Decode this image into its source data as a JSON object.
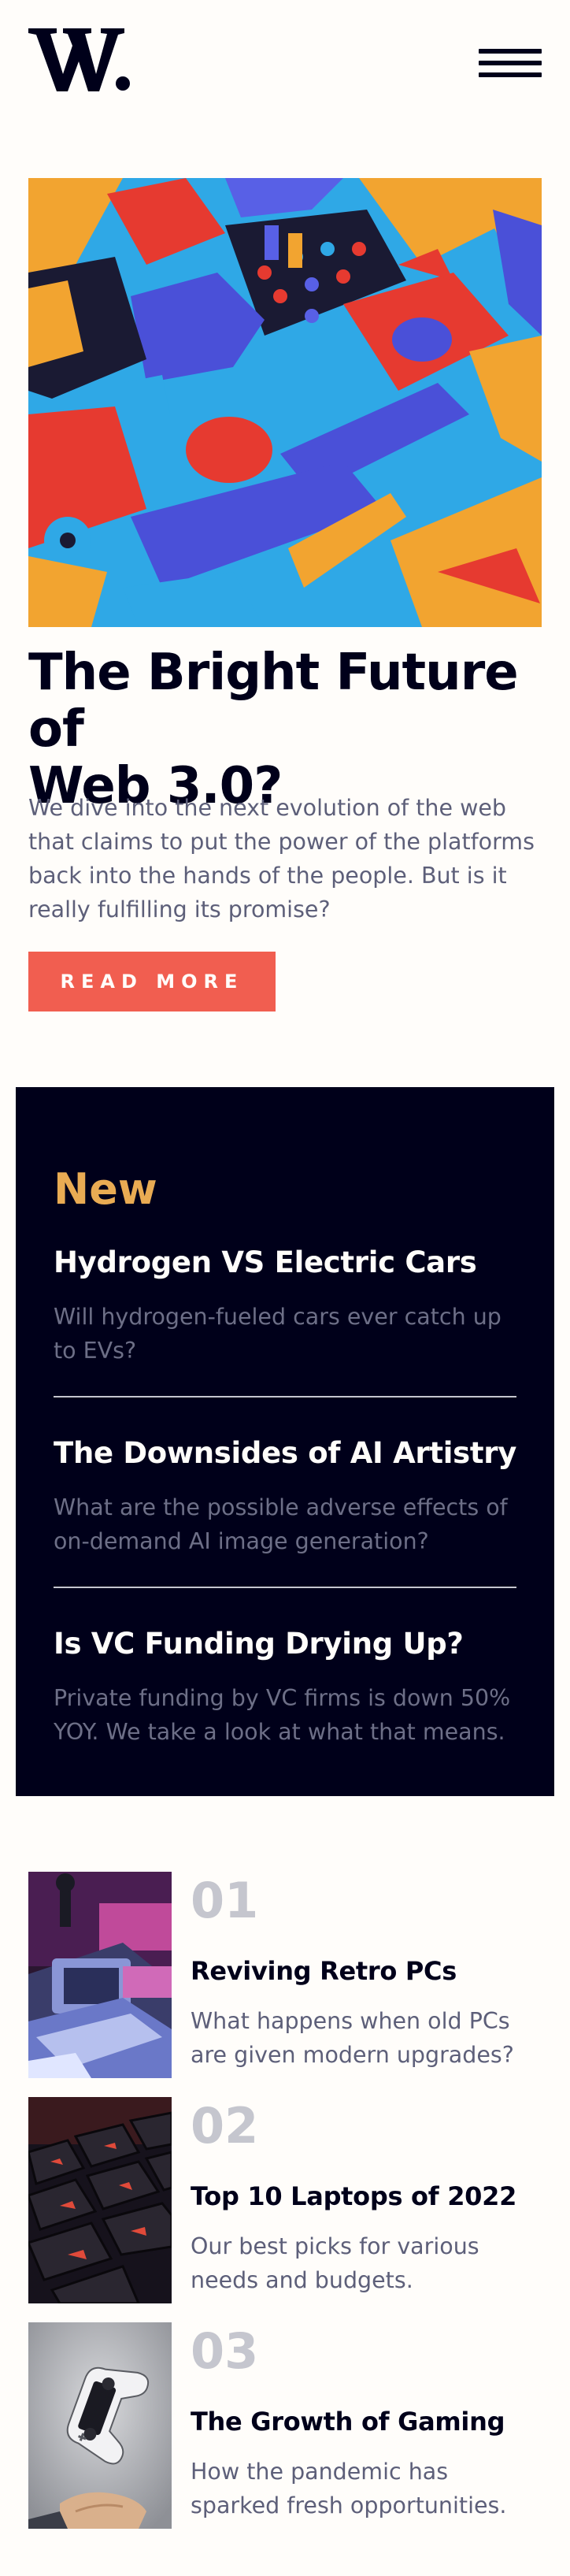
{
  "header": {
    "logo_text": "W.",
    "menu_icon": "hamburger-menu-icon"
  },
  "hero": {
    "image_icon": "abstract-3d-blocks-image",
    "title_line1": "The Bright Future of",
    "title_line2": "Web 3.0?",
    "description": "We dive into the next evolution of the web that claims to put the power of the platforms back into the hands of the people. But is it really fulfilling its promise?",
    "cta_label": "READ MORE"
  },
  "new_section": {
    "heading": "New",
    "items": [
      {
        "title": "Hydrogen VS Electric Cars",
        "description": "Will hydrogen-fueled cars ever catch up to EVs?"
      },
      {
        "title": "The Downsides of AI Artistry",
        "description": "What are the possible adverse effects of on-demand AI image generation?"
      },
      {
        "title": "Is VC Funding Drying Up?",
        "description": "Private funding by VC firms is down 50% YOY. We take a look at what that means."
      }
    ]
  },
  "articles": [
    {
      "number": "01",
      "title": "Reviving Retro PCs",
      "description": "What happens when old PCs are given modern upgrades?",
      "image_icon": "retro-pc-image"
    },
    {
      "number": "02",
      "title": "Top 10 Laptops of 2022",
      "description": "Our best picks for various needs and budgets.",
      "image_icon": "laptop-keyboard-image"
    },
    {
      "number": "03",
      "title": "The Growth of Gaming",
      "description": "How the pandemic has sparked fresh opportunities.",
      "image_icon": "game-controller-image"
    }
  ],
  "colors": {
    "background": "#fffdfa",
    "dark": "#00001a",
    "accent_red": "#f15e50",
    "accent_orange": "#e9ab53",
    "muted_text": "#5d5f79",
    "number_gray": "#c5c6ce"
  }
}
